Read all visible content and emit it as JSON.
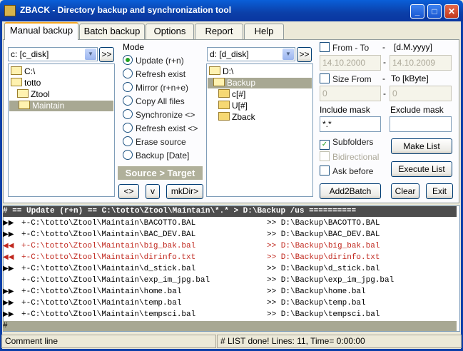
{
  "window": {
    "title": "ZBACK - Directory backup and synchronization tool",
    "min": "_",
    "max": "□",
    "close": "✕"
  },
  "tabs": [
    {
      "label": "Manual backup",
      "active": true
    },
    {
      "label": "Batch backup"
    },
    {
      "label": "Options"
    },
    {
      "label": "Report"
    },
    {
      "label": "Help"
    }
  ],
  "source": {
    "drive": "c: [c_disk]",
    "go_label": ">>",
    "tree": [
      "C:\\",
      "totto",
      "Ztool",
      "Maintain"
    ],
    "selected": "Maintain"
  },
  "mode": {
    "title": "Mode",
    "options": [
      "Update (r+n)",
      "Refresh exist",
      "Mirror (r+n+e)",
      "Copy All files",
      "Synchronize <>",
      "Refresh exist <>",
      "Erase source",
      "Backup [Date]"
    ],
    "selected": "Update (r+n)",
    "direction": "Source > Target",
    "swap_label": "<>",
    "down_label": "v",
    "mkdir_label": "mkDir>"
  },
  "target": {
    "drive": "d: [d_disk]",
    "go_label": ">>",
    "tree": [
      "D:\\",
      "Backup",
      "c[#]",
      "U[#]",
      "Zback"
    ],
    "selected": "Backup"
  },
  "filters": {
    "from_to_label": "From - To",
    "dash": "-",
    "date_format": "[d.M.yyyy]",
    "date_from": "14.10.2000",
    "date_to": "14.10.2009",
    "size_label": "Size From",
    "size_to_label": "To [kByte]",
    "size_from": "0",
    "size_to": "0",
    "include_label": "Include mask",
    "include_value": "*.*",
    "exclude_label": "Exclude mask",
    "exclude_value": "",
    "subfolders": "Subfolders",
    "bidirectional": "Bidirectional",
    "ask_before": "Ask before",
    "check_mark": "✓"
  },
  "buttons": {
    "make_list": "Make List",
    "execute_list": "Execute List",
    "add2batch": "Add2Batch",
    "clear": "Clear",
    "exit": "Exit"
  },
  "log": {
    "header": "# == Update (r+n) == C:\\totto\\Ztool\\Maintain\\*.* > D:\\Backup  /us ==========",
    "rows": [
      {
        "marker": "▶▶",
        "src": "+-C:\\totto\\Ztool\\Maintain\\BACOTTO.BAL",
        "dst": ">> D:\\Backup\\BACOTTO.BAL",
        "red": false
      },
      {
        "marker": "▶▶",
        "src": "+-C:\\totto\\Ztool\\Maintain\\BAC_DEV.BAL",
        "dst": ">> D:\\Backup\\BAC_DEV.BAL",
        "red": false
      },
      {
        "marker": "◀◀",
        "src": "+-C:\\totto\\Ztool\\Maintain\\big_bak.bal",
        "dst": ">> D:\\Backup\\big_bak.bal",
        "red": true
      },
      {
        "marker": "◀◀",
        "src": "+-C:\\totto\\Ztool\\Maintain\\dirinfo.txt",
        "dst": ">> D:\\Backup\\dirinfo.txt",
        "red": true
      },
      {
        "marker": "▶▶",
        "src": "+-C:\\totto\\Ztool\\Maintain\\d_stick.bal",
        "dst": ">> D:\\Backup\\d_stick.bal",
        "red": false
      },
      {
        "marker": "",
        "src": "+-C:\\totto\\Ztool\\Maintain\\exp_im_jpg.bal",
        "dst": ">> D:\\Backup\\exp_im_jpg.bal",
        "red": false
      },
      {
        "marker": "▶▶",
        "src": "+-C:\\totto\\Ztool\\Maintain\\home.bal",
        "dst": ">> D:\\Backup\\home.bal",
        "red": false
      },
      {
        "marker": "▶▶",
        "src": "+-C:\\totto\\Ztool\\Maintain\\temp.bal",
        "dst": ">> D:\\Backup\\temp.bal",
        "red": false
      },
      {
        "marker": "▶▶",
        "src": "+-C:\\totto\\Ztool\\Maintain\\tempsci.bal",
        "dst": ">> D:\\Backup\\tempsci.bal",
        "red": false
      }
    ],
    "footer": "#"
  },
  "status": {
    "comment": "Comment line",
    "result": "# LIST done!  Lines: 11, Time= 0:00:00"
  }
}
